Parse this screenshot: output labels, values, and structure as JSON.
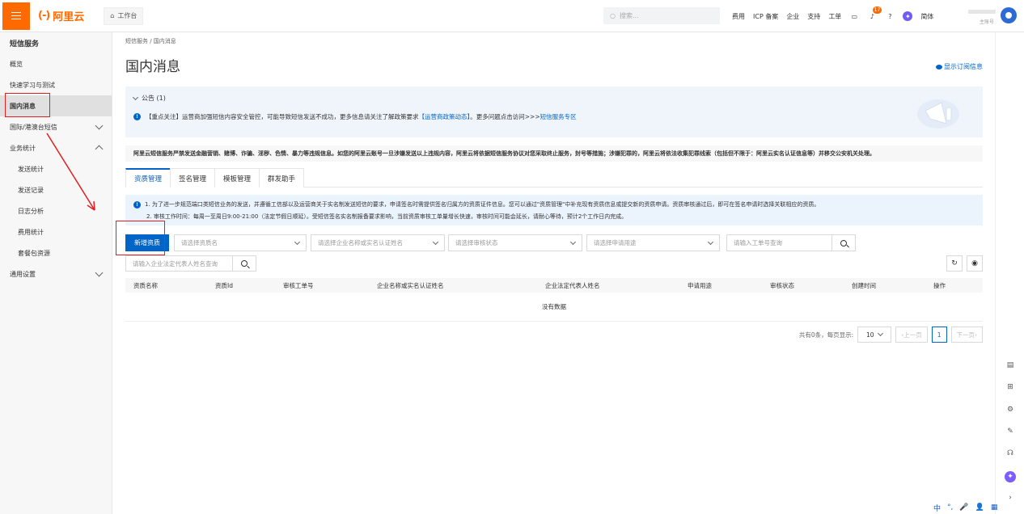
{
  "topbar": {
    "logo_mark": "(-)",
    "logo_text": "阿里云",
    "workbench": "工作台",
    "search_placeholder": "搜索...",
    "nav": [
      "费用",
      "ICP 备案",
      "企业",
      "支持",
      "工单"
    ],
    "notification_count": "17",
    "lang": "简体",
    "account_sub": "主账号"
  },
  "sidebar": {
    "title": "短信服务",
    "items": [
      {
        "label": "概览"
      },
      {
        "label": "快速学习与测试"
      },
      {
        "label": "国内消息"
      },
      {
        "label": "国际/港澳台短信"
      },
      {
        "label": "业务统计"
      },
      {
        "label": "发送统计"
      },
      {
        "label": "发送记录"
      },
      {
        "label": "日志分析"
      },
      {
        "label": "费用统计"
      },
      {
        "label": "套餐包资源"
      },
      {
        "label": "通用设置"
      }
    ]
  },
  "main": {
    "breadcrumb": "短信服务  /  国内消息",
    "title": "国内消息",
    "subscribe_link": "显示订阅信息",
    "notice": {
      "header": "公告 (1)",
      "text": "【重点关注】运营商加强短信内容安全管控，可能导致短信发送不成功，更多信息请关注了解政策要求",
      "link1": "【运营商政策动态】",
      "text2": "。更多问题点击访问>>>",
      "link2": "短信服务专区"
    },
    "warning": "阿里云短信服务严禁发送金融营销、赌博、诈骗、淫秽、色情、暴力等违规信息。如您的阿里云账号一旦涉嫌发送以上违规内容，阿里云将依据短信服务协议对您采取终止服务，封号等措施；涉嫌犯罪的，阿里云将依法收集犯罪线索（包括但不限于：阿里云实名认证信息等）并移交公安机关处理。",
    "tabs": [
      "资质管理",
      "签名管理",
      "模板管理",
      "群发助手"
    ],
    "tip_line1": "1. 为了进一步规范端口类短信业务的发送，并遵循工信部以及运营商关于实名制发送短信的要求，申请签名时需提供签名归属方的资质证件信息。您可以通过\"资质管理\"中补充现有资质信息或提交新的资质申请。资质审核通过后，即可在签名申请时选择关联相应的资质。",
    "tip_line2": "2. 审核工作时间：每周一至周日9:00-21:00（法定节假日顺延）。受短信签名实名制报备要求影响，当前资质审核工单量增长快速，审核时间可能会延长，请耐心等待，预计2个工作日内完成。",
    "add_button": "新增资质",
    "filters": {
      "qualification_name": "请选择资质名",
      "company_name": "请选择企业名称或实名认证姓名",
      "review_status": "请选择审核状态",
      "purpose": "请选择申请用途",
      "ticket_placeholder": "请输入工单号查询",
      "legal_rep_placeholder": "请输入企业法定代表人姓名查询"
    },
    "table": {
      "columns": [
        "资质名称",
        "资质Id",
        "审核工单号",
        "企业名称或实名认证姓名",
        "企业法定代表人姓名",
        "申请用途",
        "审核状态",
        "创建时间",
        "操作"
      ],
      "empty": "没有数据"
    },
    "pager": {
      "summary": "共有0条，每页显示:",
      "page_size": "10",
      "prev": "上一页",
      "current": "1",
      "next": "下一页"
    }
  },
  "ime": [
    "中",
    "°,",
    "🎤",
    "👤",
    "▦"
  ],
  "colors": {
    "brand": "#ff6a00",
    "primary": "#0064c8",
    "annotation": "#e02020"
  }
}
